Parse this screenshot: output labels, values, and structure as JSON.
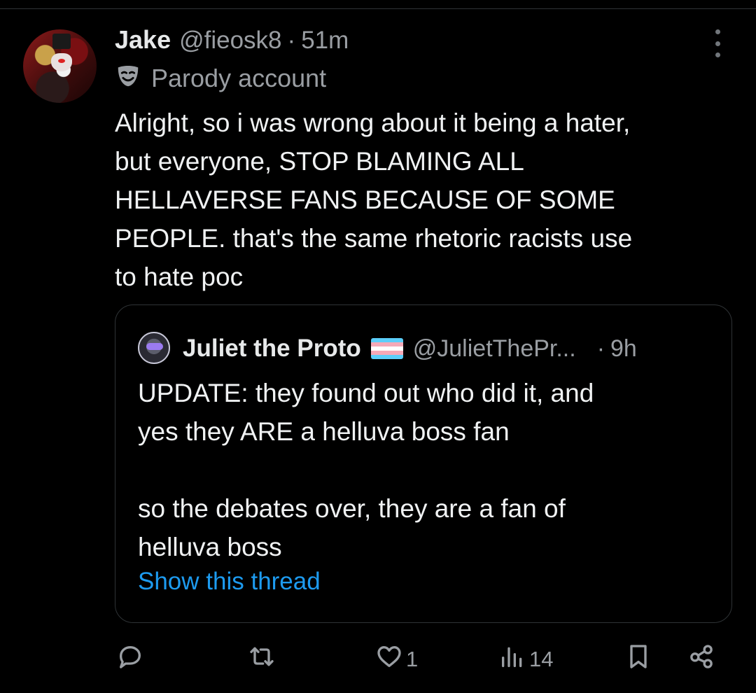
{
  "tweet": {
    "author": {
      "name": "Jake",
      "handle": "@fieosk8",
      "time": "51m",
      "label": "Parody account"
    },
    "text": "Alright, so i was wrong about it being a hater,\nbut everyone, STOP BLAMING ALL\nHELLAVERSE FANS BECAUSE OF SOME\nPEOPLE. that's the same rhetoric racists use\nto hate poc",
    "separator": "·"
  },
  "quote": {
    "author": {
      "name": "Juliet the Proto",
      "handle": "@JulietThePr...",
      "time": "9h"
    },
    "text": "UPDATE: they found out who did it, and\nyes they ARE a helluva boss fan\n\nso the debates over, they are a fan of\nhelluva boss",
    "link": "Show this thread",
    "separator": "·",
    "flag_colors": [
      "#5bcefa",
      "#f5a9b8",
      "#ffffff",
      "#f5a9b8",
      "#5bcefa"
    ]
  },
  "actions": {
    "reply": {
      "icon": "reply-icon",
      "count": ""
    },
    "retweet": {
      "icon": "retweet-icon",
      "count": ""
    },
    "like": {
      "icon": "heart-icon",
      "count": "1"
    },
    "views": {
      "icon": "views-icon",
      "count": "14"
    },
    "bookmark": {
      "icon": "bookmark-icon"
    },
    "share": {
      "icon": "share-icon"
    }
  },
  "colors": {
    "background": "#000000",
    "text": "#e7e9ea",
    "muted": "#9a9ea3",
    "link": "#1d9bf0",
    "border": "#2f3336"
  }
}
